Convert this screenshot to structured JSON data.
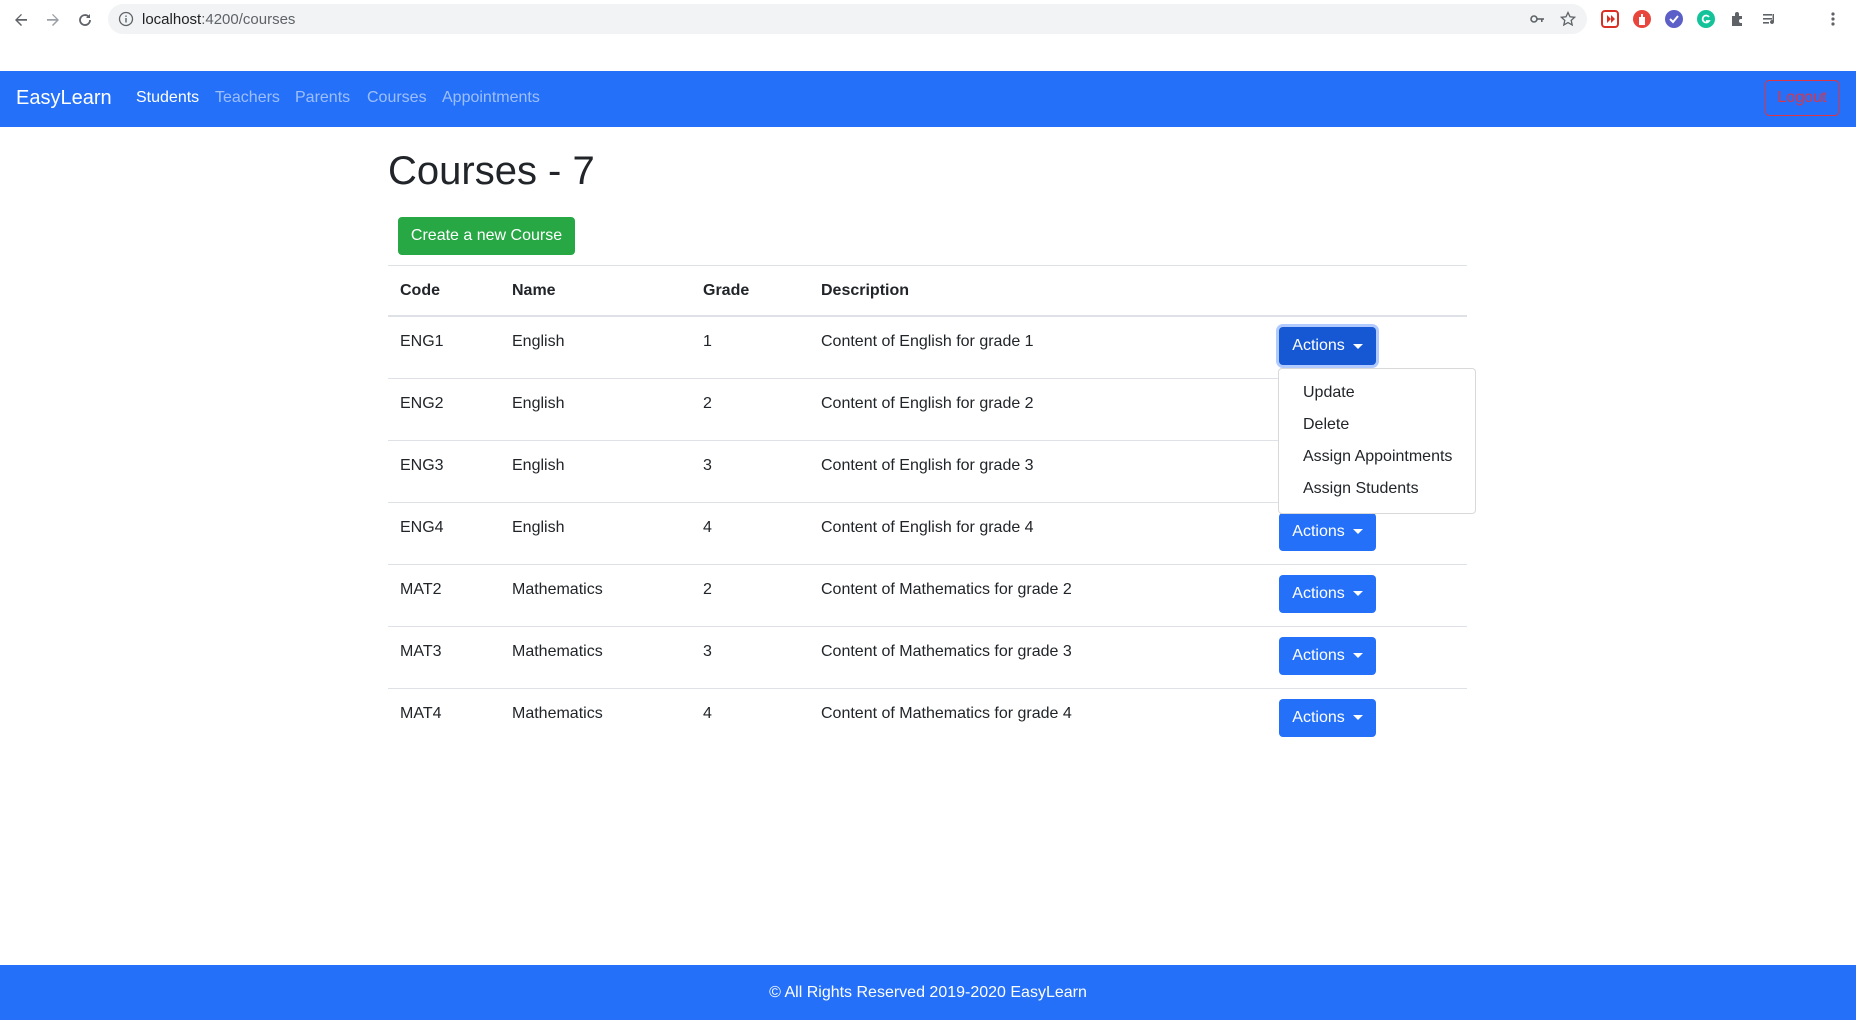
{
  "browser": {
    "url_host": "localhost",
    "url_path": ":4200/courses"
  },
  "navbar": {
    "brand": "EasyLearn",
    "links": [
      "Students",
      "Teachers",
      "Parents",
      "Courses",
      "Appointments"
    ],
    "active": "Students",
    "logout_label": "Logout"
  },
  "main": {
    "title": "Courses - 7",
    "create_button": "Create a new Course",
    "table": {
      "headers": [
        "Code",
        "Name",
        "Grade",
        "Description"
      ],
      "rows": [
        {
          "code": "ENG1",
          "name": "English",
          "grade": "1",
          "description": "Content of English for grade 1"
        },
        {
          "code": "ENG2",
          "name": "English",
          "grade": "2",
          "description": "Content of English for grade 2"
        },
        {
          "code": "ENG3",
          "name": "English",
          "grade": "3",
          "description": "Content of English for grade 3"
        },
        {
          "code": "ENG4",
          "name": "English",
          "grade": "4",
          "description": "Content of English for grade 4"
        },
        {
          "code": "MAT2",
          "name": "Mathematics",
          "grade": "2",
          "description": "Content of Mathematics for grade 2"
        },
        {
          "code": "MAT3",
          "name": "Mathematics",
          "grade": "3",
          "description": "Content of Mathematics for grade 3"
        },
        {
          "code": "MAT4",
          "name": "Mathematics",
          "grade": "4",
          "description": "Content of Mathematics for grade 4"
        }
      ],
      "actions_label": "Actions"
    },
    "dropdown": {
      "open_row": 0,
      "items": [
        "Update",
        "Delete",
        "Assign Appointments",
        "Assign Students"
      ]
    }
  },
  "footer": {
    "text": "© All Rights Reserved 2019-2020 EasyLearn"
  },
  "colors": {
    "primary": "#2470f9",
    "success": "#28a745",
    "danger": "#dc3545"
  },
  "icons": {
    "toolbar": [
      "back-icon",
      "forward-icon",
      "reload-icon",
      "info-icon",
      "key-icon",
      "star-icon"
    ],
    "extensions": [
      "extension-red-icon",
      "extension-shield-icon",
      "extension-purple-icon",
      "grammarly-icon",
      "puzzle-icon",
      "media-icon",
      "menu-icon"
    ]
  }
}
